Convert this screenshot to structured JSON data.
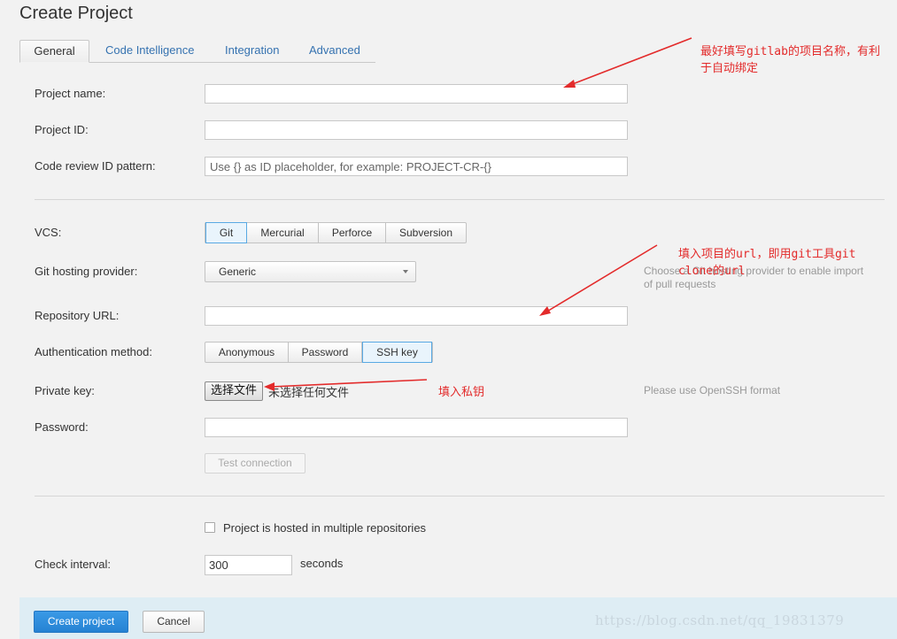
{
  "page": {
    "title": "Create Project"
  },
  "tabs": [
    {
      "label": "General"
    },
    {
      "label": "Code Intelligence"
    },
    {
      "label": "Integration"
    },
    {
      "label": "Advanced"
    }
  ],
  "form": {
    "project_name_label": "Project name:",
    "project_name_value": "",
    "project_id_label": "Project ID:",
    "project_id_value": "",
    "review_id_label": "Code review ID pattern:",
    "review_id_placeholder": "Use {} as ID placeholder, for example: PROJECT-CR-{}",
    "vcs_label": "VCS:",
    "vcs_options": [
      "Git",
      "Mercurial",
      "Perforce",
      "Subversion"
    ],
    "vcs_selected": "Git",
    "hosting_label": "Git hosting provider:",
    "hosting_value": "Generic",
    "hosting_hint": "Choose a Git hosting provider to enable import of pull requests",
    "repo_url_label": "Repository URL:",
    "repo_url_value": "",
    "auth_label": "Authentication method:",
    "auth_options": [
      "Anonymous",
      "Password",
      "SSH key"
    ],
    "auth_selected": "SSH key",
    "private_key_label": "Private key:",
    "file_button": "选择文件",
    "file_status": "未选择任何文件",
    "private_key_hint": "Please use OpenSSH format",
    "password_label": "Password:",
    "password_value": "",
    "test_connection": "Test connection",
    "multi_repo_label": "Project is hosted in multiple repositories",
    "multi_repo_checked": false,
    "interval_label": "Check interval:",
    "interval_value": "300",
    "interval_unit": "seconds"
  },
  "footer": {
    "create_button": "Create project",
    "cancel_button": "Cancel"
  },
  "annotations": {
    "project_name_note": "最好填写gitlab的项目名称，有利于自动绑定",
    "repo_url_note": "填入项目的url，即用git工具git clone的url",
    "private_key_note": "填入私钥",
    "color": "#e32b2b"
  },
  "watermark": "https://blog.csdn.net/qq_19831379",
  "colors": {
    "primary": "#2682d3",
    "link": "#3572b0",
    "footer_bg": "#deedf4",
    "annotation": "#e32b2b"
  }
}
